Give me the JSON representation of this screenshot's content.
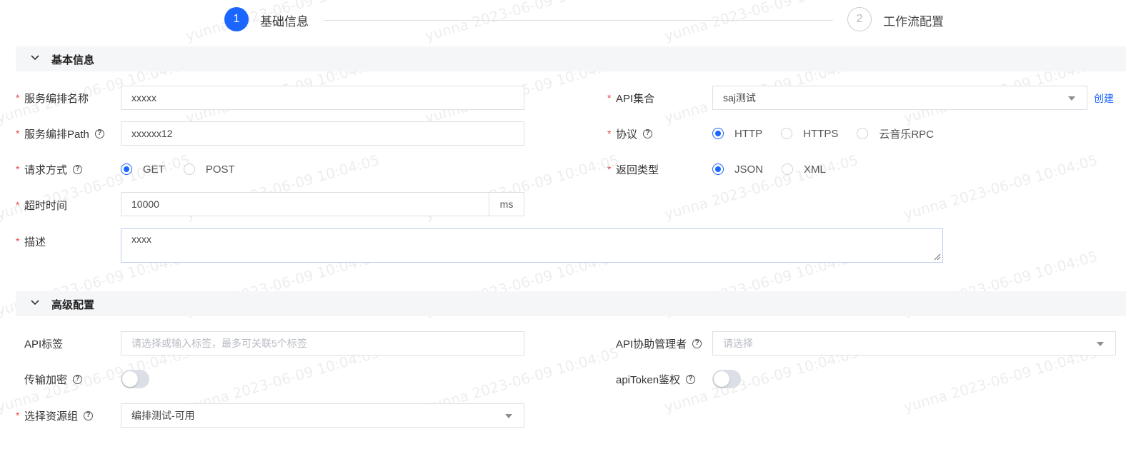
{
  "steps": [
    {
      "number": "1",
      "title": "基础信息"
    },
    {
      "number": "2",
      "title": "工作流配置"
    }
  ],
  "sections": {
    "basic": "基本信息",
    "advanced": "高级配置"
  },
  "watermark": "yunna 2023-06-09 10:04:05",
  "fields": {
    "service_name": {
      "label": "服务编排名称",
      "value": "xxxxx"
    },
    "service_path": {
      "label": "服务编排Path",
      "value": "xxxxxx12"
    },
    "request_method": {
      "label": "请求方式",
      "options": [
        "GET",
        "POST"
      ],
      "selected": "GET"
    },
    "timeout": {
      "label": "超时时间",
      "value": "10000",
      "suffix": "ms"
    },
    "description": {
      "label": "描述",
      "value": "xxxx"
    },
    "api_collection": {
      "label": "API集合",
      "value": "saj测试",
      "create_link": "创建"
    },
    "protocol": {
      "label": "协议",
      "options": [
        "HTTP",
        "HTTPS",
        "云音乐RPC"
      ],
      "selected": "HTTP"
    },
    "return_type": {
      "label": "返回类型",
      "options": [
        "JSON",
        "XML"
      ],
      "selected": "JSON"
    },
    "api_tags": {
      "label": "API标签",
      "placeholder": "请选择或输入标签，最多可关联5个标签"
    },
    "api_co_managers": {
      "label": "API协助管理者",
      "placeholder": "请选择"
    },
    "transfer_encryption": {
      "label": "传输加密",
      "enabled": false
    },
    "api_token_auth": {
      "label": "apiToken鉴权",
      "enabled": false
    },
    "resource_group": {
      "label": "选择资源组",
      "value": "编排测试-可用"
    }
  },
  "colors": {
    "primary": "#1a66ff",
    "required": "#e5484d",
    "section_bg": "#f5f6f8",
    "border": "#dcdfe6"
  }
}
